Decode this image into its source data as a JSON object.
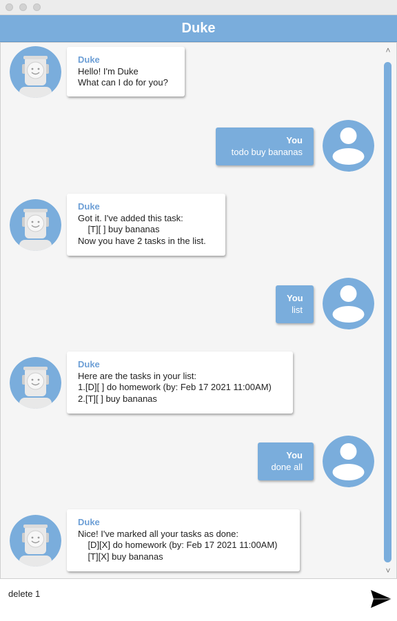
{
  "window": {
    "title": "Duke"
  },
  "colors": {
    "accent": "#7aaddc",
    "bot_name": "#6d9fd6",
    "chat_bg": "#f5f5f5"
  },
  "messages": [
    {
      "sender": "Duke",
      "lines": [
        "Hello! I'm Duke",
        "What can I do for you?"
      ]
    },
    {
      "sender": "You",
      "lines": [
        "todo buy bananas"
      ]
    },
    {
      "sender": "Duke",
      "lines": [
        "Got it. I've added this task:",
        "    [T][ ] buy bananas",
        "Now you have 2 tasks in the list."
      ]
    },
    {
      "sender": "You",
      "lines": [
        "list"
      ]
    },
    {
      "sender": "Duke",
      "lines": [
        "Here are the tasks in your list:",
        "1.[D][ ] do homework (by: Feb 17 2021 11:00AM)",
        "2.[T][ ] buy bananas"
      ]
    },
    {
      "sender": "You",
      "lines": [
        "done all"
      ]
    },
    {
      "sender": "Duke",
      "lines": [
        "Nice! I've marked all your tasks as done:",
        "    [D][X] do homework (by: Feb 17 2021 11:00AM)",
        "    [T][X] buy bananas"
      ]
    }
  ],
  "input": {
    "value": "delete 1"
  },
  "icons": {
    "send": "send-icon",
    "bot_avatar": "robot-icon",
    "user_avatar": "user-icon",
    "scroll_up": "chevron-up-icon",
    "scroll_down": "chevron-down-icon"
  },
  "scroll": {
    "up_glyph": "˄",
    "down_glyph": "˅"
  }
}
